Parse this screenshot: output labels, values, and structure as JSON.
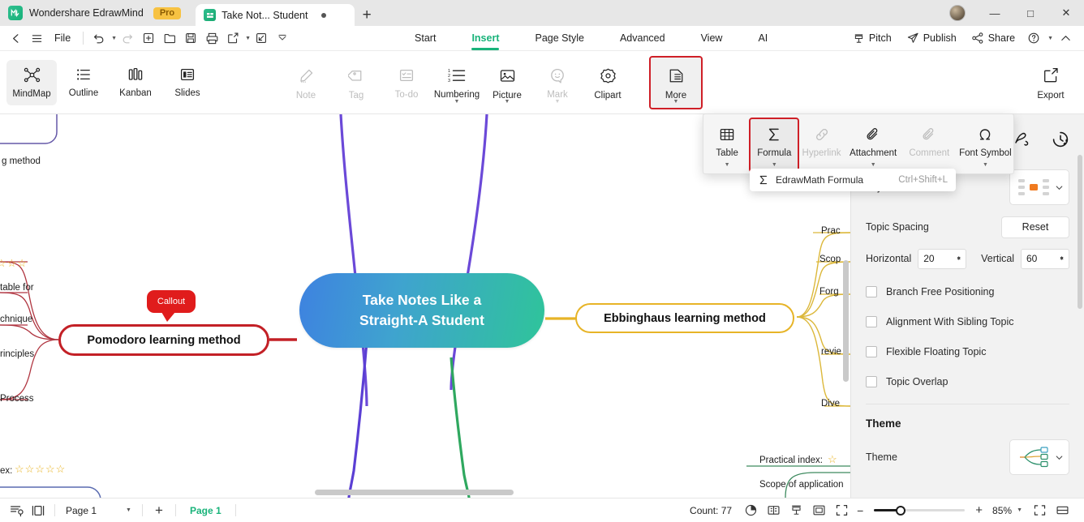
{
  "titlebar": {
    "app_name": "Wondershare EdrawMind",
    "pro_badge": "Pro",
    "document_tab": "Take Not... Student",
    "new_tab_label": "+",
    "minimize": "—",
    "maximize": "□",
    "close": "✕"
  },
  "quickaccess": {
    "back": "back-arrow",
    "menu": "hamburger",
    "file_label": "File",
    "undo": "undo",
    "redo": "redo",
    "new": "new-page",
    "open": "open-folder",
    "save": "save-disk",
    "print": "print",
    "export_share": "export",
    "collapse": "collapse",
    "more": "more-chevron"
  },
  "ribbon_tabs": [
    {
      "label": "Start",
      "active": false
    },
    {
      "label": "Insert",
      "active": true
    },
    {
      "label": "Page Style",
      "active": false
    },
    {
      "label": "Advanced",
      "active": false
    },
    {
      "label": "View",
      "active": false
    },
    {
      "label": "AI",
      "active": false
    }
  ],
  "header_actions": [
    {
      "label": "Pitch",
      "icon": "pitch-icon"
    },
    {
      "label": "Publish",
      "icon": "publish-icon"
    },
    {
      "label": "Share",
      "icon": "share-icon"
    }
  ],
  "help_label": "?",
  "view_modes": [
    {
      "label": "MindMap",
      "icon": "mindmap-icon",
      "selected": true
    },
    {
      "label": "Outline",
      "icon": "outline-icon",
      "selected": false
    },
    {
      "label": "Kanban",
      "icon": "kanban-icon",
      "selected": false
    },
    {
      "label": "Slides",
      "icon": "slides-icon",
      "selected": false
    }
  ],
  "insert_items": [
    {
      "label": "Note",
      "icon": "note-icon",
      "disabled": true,
      "dropdown": false
    },
    {
      "label": "Tag",
      "icon": "tag-icon",
      "disabled": true,
      "dropdown": false
    },
    {
      "label": "To-do",
      "icon": "todo-icon",
      "disabled": true,
      "dropdown": false
    },
    {
      "label": "Numbering",
      "icon": "numbering-icon",
      "disabled": false,
      "dropdown": true
    },
    {
      "label": "Picture",
      "icon": "picture-icon",
      "disabled": false,
      "dropdown": true
    },
    {
      "label": "Mark",
      "icon": "mark-icon",
      "disabled": true,
      "dropdown": true
    },
    {
      "label": "Clipart",
      "icon": "clipart-icon",
      "disabled": false,
      "dropdown": false
    },
    {
      "label": "More",
      "icon": "more-icon",
      "disabled": false,
      "dropdown": true,
      "highlighted": true
    }
  ],
  "export_label": "Export",
  "flyout_items": [
    {
      "label": "Table",
      "icon": "table-icon",
      "disabled": false,
      "dropdown": true
    },
    {
      "label": "Formula",
      "icon": "sigma-icon",
      "disabled": false,
      "dropdown": true,
      "highlighted": true
    },
    {
      "label": "Hyperlink",
      "icon": "link-icon",
      "disabled": true,
      "dropdown": false
    },
    {
      "label": "Attachment",
      "icon": "paperclip-icon",
      "disabled": false,
      "dropdown": true
    },
    {
      "label": "Comment",
      "icon": "comment-clip-icon",
      "disabled": true,
      "dropdown": false
    },
    {
      "label": "Font Symbol",
      "icon": "omega-icon",
      "disabled": false,
      "dropdown": true
    }
  ],
  "submenu": {
    "icon": "sigma-icon",
    "label": "EdrawMath Formula",
    "shortcut": "Ctrl+Shift+L"
  },
  "canvas": {
    "central_topic_line1": "Take Notes Like a",
    "central_topic_line2": "Straight-A Student",
    "callout_label": "Callout",
    "pomodoro_topic": "Pomodoro learning method",
    "ebbinghaus_topic": "Ebbinghaus learning method",
    "clipped_top_left": "g method",
    "left_stars": "☆☆☆",
    "left_leaves": [
      "table for",
      "chnique",
      "rinciples",
      "Process"
    ],
    "bottom_left_label": "ex:",
    "bottom_left_stars": "☆☆☆☆☆",
    "right_leaves": [
      "Prac",
      "Scop",
      "Forg",
      "revie",
      "Dive"
    ],
    "bottom_right_leaf1": "Practical index:",
    "bottom_right_star": "☆",
    "bottom_right_leaf2": "Scope of application"
  },
  "right_panel": {
    "toolbar_icons": [
      "style-icon",
      "history-icon"
    ],
    "layout_label": "Layout",
    "topic_spacing_label": "Topic Spacing",
    "reset_label": "Reset",
    "horizontal_label": "Horizontal",
    "horizontal_value": "20",
    "vertical_label": "Vertical",
    "vertical_value": "60",
    "checkboxes": [
      {
        "label": "Branch Free Positioning",
        "checked": false
      },
      {
        "label": "Alignment With Sibling Topic",
        "checked": false
      },
      {
        "label": "Flexible Floating Topic",
        "checked": false
      },
      {
        "label": "Topic Overlap",
        "checked": false
      }
    ],
    "theme_heading": "Theme",
    "theme_label": "Theme"
  },
  "status_bar": {
    "outline_icon": "outline-view-icon",
    "presentation_icon": "presentation-icon",
    "page_selector": "Page 1",
    "add_page": "+",
    "current_page": "Page 1",
    "count_label": "Count: 77",
    "right_icons": [
      "pie-icon",
      "book-icon",
      "pitch-icon",
      "frame-icon",
      "fit-icon"
    ],
    "zoom_out": "−",
    "zoom_in": "+",
    "zoom_value": "85%",
    "fullscreen_icon": "fullscreen-icon",
    "fitwidth_icon": "fit-width-icon"
  },
  "colors": {
    "accent_green": "#19b37a",
    "pro_badge": "#f7c242",
    "highlight_red": "#cf1f27",
    "pomodoro_red": "#c32026",
    "ebbinghaus_yellow": "#e7b427",
    "central_blue": "#3e82e0",
    "central_teal": "#2fc49a"
  }
}
